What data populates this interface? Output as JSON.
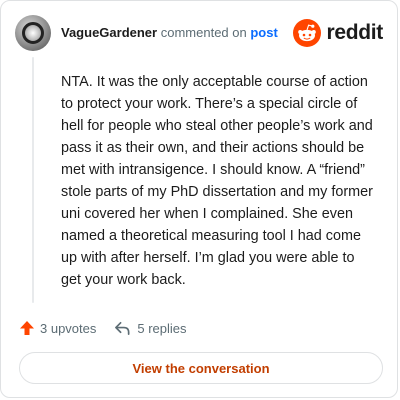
{
  "header": {
    "username": "VagueGardener",
    "action_text": "commented on",
    "post_link": "post",
    "brand_name": "reddit",
    "brand_color": "#ff4500"
  },
  "comment": {
    "body": "NTA. It was the only acceptable course of action\nto protect your work. There’s a special circle of\nhell for people who steal other people’s work and\npass it as their own, and their actions should be\nmet with intransigence. I should know. A “friend”\nstole parts of my PhD dissertation and my former\nuni covered her when I complained. She even\nnamed a theoretical measuring tool I had come\nup with after herself. I’m glad you were able to\nget your work back."
  },
  "actions": {
    "upvotes": "3 upvotes",
    "replies": "5 replies",
    "upvote_icon": "upvote-arrow-icon",
    "reply_icon": "reply-arrow-icon",
    "upvote_color": "#ff4500"
  },
  "cta": {
    "label": "View the conversation",
    "color": "#c23e00"
  }
}
